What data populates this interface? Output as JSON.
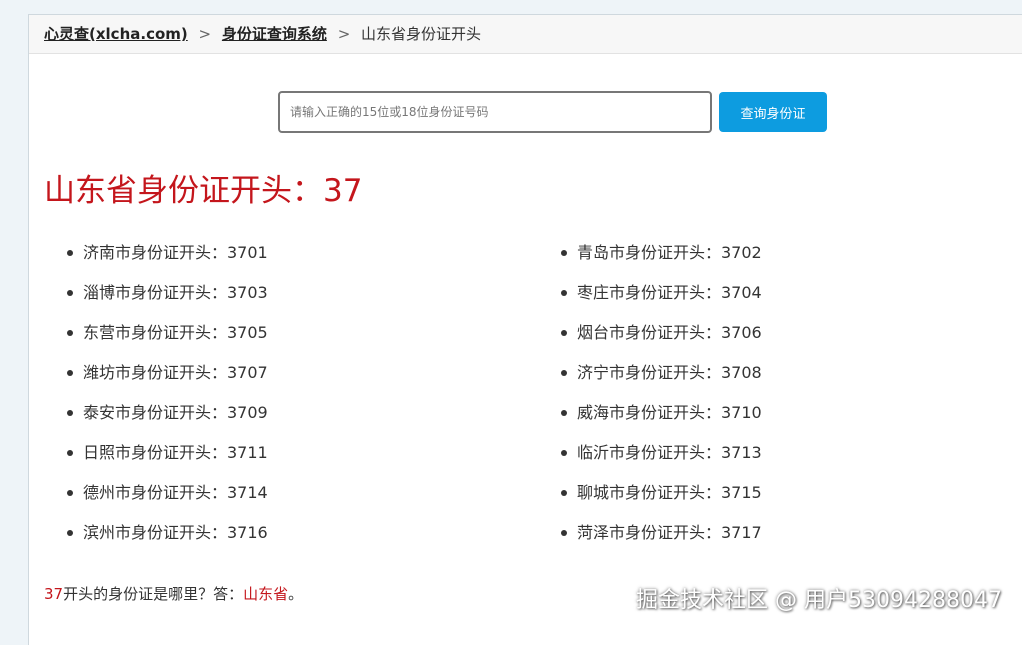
{
  "breadcrumb": {
    "home_label": "心灵查(xlcha.com)",
    "section_label": "身份证查询系统",
    "current_label": "山东省身份证开头",
    "separator": ">"
  },
  "search": {
    "placeholder": "请输入正确的15位或18位身份证号码",
    "button_label": "查询身份证"
  },
  "title": "山东省身份证开头：37",
  "cities": [
    {
      "label": "济南市身份证开头：3701"
    },
    {
      "label": "青岛市身份证开头：3702"
    },
    {
      "label": "淄博市身份证开头：3703"
    },
    {
      "label": "枣庄市身份证开头：3704"
    },
    {
      "label": "东营市身份证开头：3705"
    },
    {
      "label": "烟台市身份证开头：3706"
    },
    {
      "label": "潍坊市身份证开头：3707"
    },
    {
      "label": "济宁市身份证开头：3708"
    },
    {
      "label": "泰安市身份证开头：3709"
    },
    {
      "label": "威海市身份证开头：3710"
    },
    {
      "label": "日照市身份证开头：3711"
    },
    {
      "label": "临沂市身份证开头：3713"
    },
    {
      "label": "德州市身份证开头：3714"
    },
    {
      "label": "聊城市身份证开头：3715"
    },
    {
      "label": "滨州市身份证开头：3716"
    },
    {
      "label": "菏泽市身份证开头：3717"
    }
  ],
  "answer": {
    "code": "37",
    "question": "开头的身份证是哪里？答：",
    "province": "山东省",
    "end": "。"
  },
  "watermark": "掘金技术社区 @ 用户53094288047",
  "colors": {
    "accent_red": "#c4161c",
    "button_blue": "#0d9ce0"
  }
}
